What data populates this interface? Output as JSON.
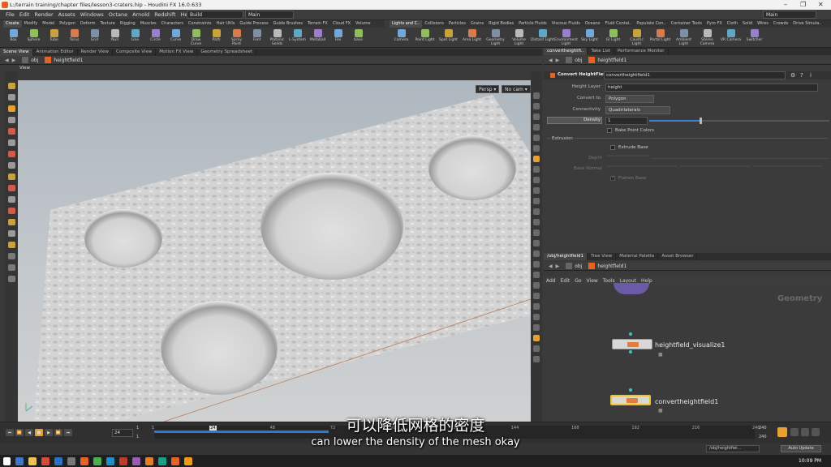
{
  "window": {
    "title": "L:/terrain training/chapter files/lesson3-craters.hip - Houdini FX 16.0.633"
  },
  "menu": {
    "items": [
      "File",
      "Edit",
      "Render",
      "Assets",
      "Windows",
      "Octane",
      "Arnold",
      "Redshift",
      "Help"
    ],
    "desktop": "Build",
    "layout": "Main",
    "right_desktop": "Main"
  },
  "shelf": {
    "left_tabs": [
      "Create",
      "Modify",
      "Model",
      "Polygon",
      "Deform",
      "Texture",
      "Rigging",
      "Muscles",
      "Characters",
      "Constraints",
      "Hair Utils",
      "Guide Process",
      "Guide Brushes",
      "Terrain FX",
      "Cloud FX",
      "Volume"
    ],
    "left_tools": [
      "Box",
      "Sphere",
      "Tube",
      "Torus",
      "Grid",
      "Null",
      "Line",
      "Circle",
      "Curve",
      "Draw Curve",
      "Path",
      "Spray Paint",
      "Font",
      "Platonic Solids",
      "L-System",
      "Metaball",
      "File",
      "base"
    ],
    "right_tabs": [
      "Lights and C..",
      "Collisions",
      "Particles",
      "Grains",
      "Rigid Bodies",
      "Particle Fluids",
      "Viscous Fluids",
      "Oceans",
      "Fluid Contai..",
      "Populate Con..",
      "Container Tools",
      "Pyro FX",
      "Cloth",
      "Solid",
      "Wires",
      "Crowds",
      "Drive Simula.."
    ],
    "right_tools": [
      "Camera",
      "Point Light",
      "Spot Light",
      "Area Light",
      "Geometry Light",
      "Volume Light",
      "Distant Light",
      "Environment Light",
      "Sky Light",
      "GI Light",
      "Caustic Light",
      "Portal Light",
      "Ambient Light",
      "Stereo Camera",
      "VR Camera",
      "Switcher"
    ]
  },
  "scene_tabs": [
    "Scene View",
    "Animation Editor",
    "Render View",
    "Composite View",
    "Motion FX View",
    "Geometry Spreadsheet"
  ],
  "scene_path": {
    "context": "obj",
    "node": "heightfield1"
  },
  "viewport": {
    "label": "View",
    "persp": "Persp ▾",
    "cam": "No cam ▾"
  },
  "params": {
    "tabs": [
      "convertheightfi..",
      "Take List",
      "Performance Monitor"
    ],
    "path": {
      "context": "obj",
      "node": "heightfield1"
    },
    "node_type": "Convert HeightField",
    "node_name": "convertheightfield1",
    "height_layer": {
      "label": "Height Layer",
      "value": "height"
    },
    "convert_to": {
      "label": "Convert to",
      "value": "Polygon"
    },
    "connectivity": {
      "label": "Connectivity",
      "value": "Quadrilaterals"
    },
    "density": {
      "label": "Density",
      "value": "1",
      "slider_fraction": 0.28
    },
    "bake_point_colors": {
      "label": "Bake Point Colors",
      "checked": false
    },
    "extrusion": {
      "label": "Extrusion"
    },
    "extrude_base": {
      "label": "Extrude Base",
      "checked": false
    },
    "depth": {
      "label": "Depth"
    },
    "base_normal": {
      "label": "Base Normal"
    },
    "flatten_base": {
      "label": "Flatten Base",
      "checked": true
    }
  },
  "network": {
    "tabs": [
      "/obj/heightfield1",
      "Tree View",
      "Material Palette",
      "Asset Browser"
    ],
    "path": {
      "context": "obj",
      "node": "heightfield1"
    },
    "menu": [
      "Add",
      "Edit",
      "Go",
      "View",
      "Tools",
      "Layout",
      "Help"
    ],
    "context_label": "Geometry",
    "nodes": [
      {
        "name": "heightfield_visualize1",
        "selected": false
      },
      {
        "name": "convertheightfield1",
        "selected": true
      }
    ]
  },
  "timeline": {
    "current_frame": "24",
    "start": "1",
    "start2": "1",
    "ticks": [
      "1",
      "24",
      "48",
      "72",
      "96",
      "120",
      "144",
      "168",
      "192",
      "216",
      "240"
    ],
    "end": "240",
    "end2": "240",
    "range_fraction": 0.29
  },
  "status": {
    "path": "/obj/heightfiel...",
    "auto_update": "Auto Update"
  },
  "taskbar": {
    "time": "10:09 PM"
  },
  "subtitles": {
    "chinese": "可以降低网格的密度",
    "english": "can lower the density of the mesh okay"
  },
  "colors": {
    "houdini_orange": "#e8641e",
    "node_selected": "#f0c420",
    "wire_dot": "#3bc7b8",
    "timeline_blue": "#2b79d6"
  }
}
